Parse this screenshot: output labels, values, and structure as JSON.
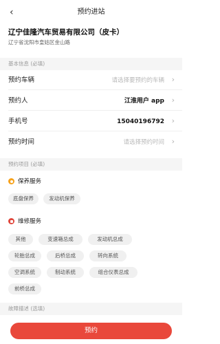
{
  "nav": {
    "back_icon": "chevron-left-icon",
    "title": "预约进站"
  },
  "shop": {
    "name": "辽宁佳隆汽车贸易有限公司（皮卡）",
    "address": "辽宁省沈阳市皇姑区金山路"
  },
  "basic_section": {
    "title": "基本信息 (必填)"
  },
  "rows": {
    "vehicle": {
      "label": "预约车辆",
      "placeholder": "请选择要预约的车辆"
    },
    "person": {
      "label": "预约人",
      "value": "江淮用户 app"
    },
    "phone": {
      "label": "手机号",
      "value": "15040196792"
    },
    "time": {
      "label": "预约时间",
      "placeholder": "请选择预约时间"
    }
  },
  "project_section": {
    "title": "预约项目 (必填)"
  },
  "maintenance": {
    "title": "保养服务",
    "icon": "maintenance-icon",
    "chips": [
      "底盘保养",
      "发动机保养"
    ]
  },
  "repair": {
    "title": "维修服务",
    "icon": "repair-icon",
    "chips": [
      "其他",
      "变速箱总成",
      "发动机总成",
      "轮胎总成",
      "后桥总成",
      "转向系统",
      "空调系统",
      "制动系统",
      "组合仪表总成",
      "前桥总成"
    ]
  },
  "fault_section": {
    "title": "故障描述 (选填)"
  },
  "submit": {
    "label": "预约"
  },
  "colors": {
    "accent": "#e9483b",
    "maintenance_icon": "#f7a21b",
    "repair_icon": "#e0463b"
  }
}
